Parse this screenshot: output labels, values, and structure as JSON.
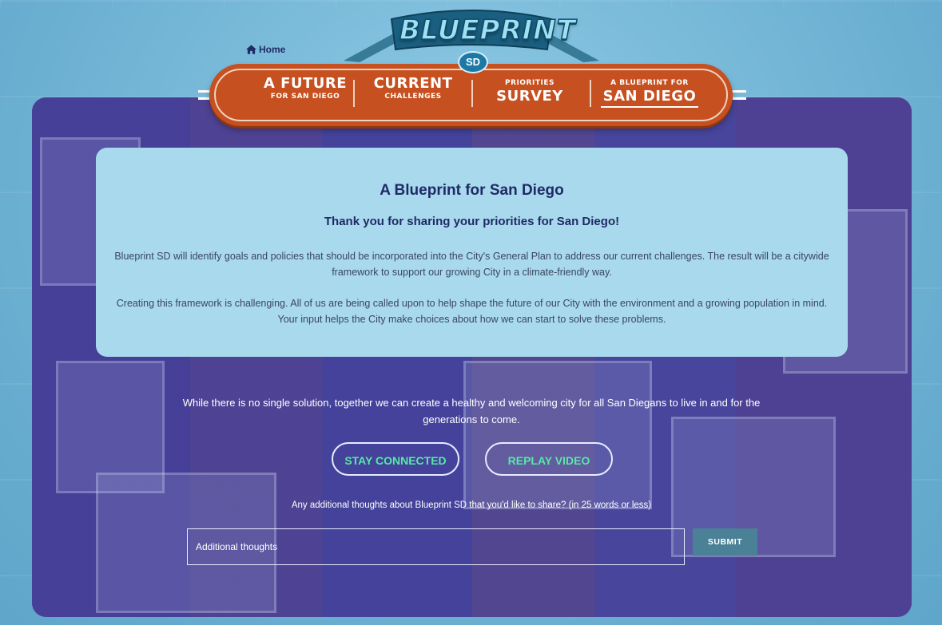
{
  "header": {
    "home_label": "Home",
    "logo_text": "BLUEPRINT",
    "logo_badge": "SD"
  },
  "nav": {
    "items": [
      {
        "big": "A FUTURE",
        "small": "FOR SAN DIEGO",
        "order": "big-first"
      },
      {
        "big": "CURRENT",
        "small": "CHALLENGES",
        "order": "big-first"
      },
      {
        "big": "SURVEY",
        "small": "PRIORITIES",
        "order": "small-first"
      },
      {
        "big": "SAN DIEGO",
        "small": "A BLUEPRINT FOR",
        "order": "small-first",
        "current": true
      }
    ]
  },
  "info": {
    "title": "A Blueprint for San Diego",
    "subtitle": "Thank you for sharing your priorities for San Diego!",
    "paragraph1": "Blueprint SD will identify goals and policies that should be incorporated into the City's General Plan to address our current challenges. The result will be a citywide framework to support our growing City in a climate-friendly way.",
    "paragraph2": "Creating this framework is challenging. All of us are being called upon to help shape the future of our City with the environment and a growing population in mind. Your input helps the City make choices about how we can start to solve these problems."
  },
  "closing": {
    "text": "While there is no single solution, together we can create a healthy and welcoming city for all San Diegans to live in and for the generations to come."
  },
  "actions": {
    "stay_connected": "STAY CONNECTED",
    "replay_video": "REPLAY VIDEO"
  },
  "feedback": {
    "question": "Any additional thoughts about Blueprint SD that you'd like to share? (in 25 words or less)",
    "placeholder": "Additional thoughts",
    "submit_label": "SUBMIT"
  },
  "colors": {
    "nav_orange": "#c6501f",
    "button_text_green": "#58e8a8",
    "panel_blue": "#a8d9ec",
    "heading_navy": "#1f2a66"
  }
}
